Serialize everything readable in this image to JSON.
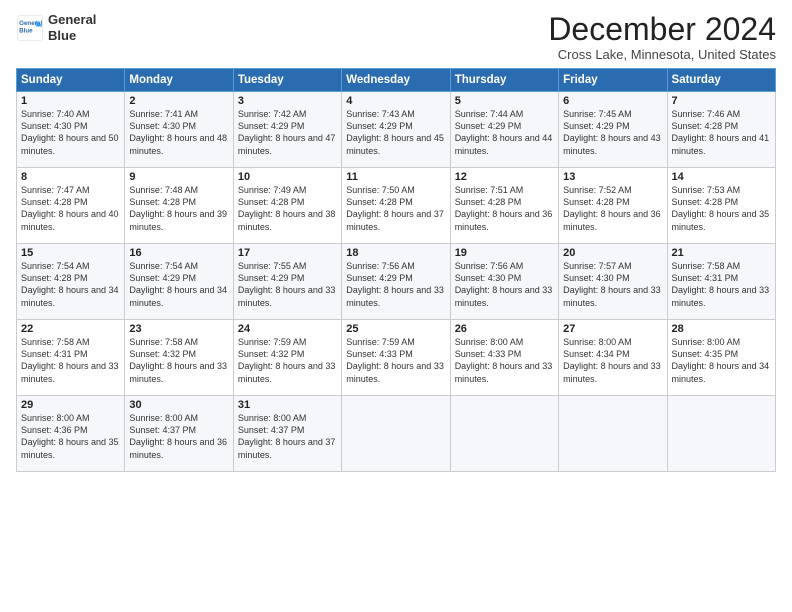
{
  "header": {
    "logo_line1": "General",
    "logo_line2": "Blue",
    "month_title": "December 2024",
    "location": "Cross Lake, Minnesota, United States"
  },
  "days_of_week": [
    "Sunday",
    "Monday",
    "Tuesday",
    "Wednesday",
    "Thursday",
    "Friday",
    "Saturday"
  ],
  "weeks": [
    [
      {
        "day": "1",
        "sunrise": "Sunrise: 7:40 AM",
        "sunset": "Sunset: 4:30 PM",
        "daylight": "Daylight: 8 hours and 50 minutes."
      },
      {
        "day": "2",
        "sunrise": "Sunrise: 7:41 AM",
        "sunset": "Sunset: 4:30 PM",
        "daylight": "Daylight: 8 hours and 48 minutes."
      },
      {
        "day": "3",
        "sunrise": "Sunrise: 7:42 AM",
        "sunset": "Sunset: 4:29 PM",
        "daylight": "Daylight: 8 hours and 47 minutes."
      },
      {
        "day": "4",
        "sunrise": "Sunrise: 7:43 AM",
        "sunset": "Sunset: 4:29 PM",
        "daylight": "Daylight: 8 hours and 45 minutes."
      },
      {
        "day": "5",
        "sunrise": "Sunrise: 7:44 AM",
        "sunset": "Sunset: 4:29 PM",
        "daylight": "Daylight: 8 hours and 44 minutes."
      },
      {
        "day": "6",
        "sunrise": "Sunrise: 7:45 AM",
        "sunset": "Sunset: 4:29 PM",
        "daylight": "Daylight: 8 hours and 43 minutes."
      },
      {
        "day": "7",
        "sunrise": "Sunrise: 7:46 AM",
        "sunset": "Sunset: 4:28 PM",
        "daylight": "Daylight: 8 hours and 41 minutes."
      }
    ],
    [
      {
        "day": "8",
        "sunrise": "Sunrise: 7:47 AM",
        "sunset": "Sunset: 4:28 PM",
        "daylight": "Daylight: 8 hours and 40 minutes."
      },
      {
        "day": "9",
        "sunrise": "Sunrise: 7:48 AM",
        "sunset": "Sunset: 4:28 PM",
        "daylight": "Daylight: 8 hours and 39 minutes."
      },
      {
        "day": "10",
        "sunrise": "Sunrise: 7:49 AM",
        "sunset": "Sunset: 4:28 PM",
        "daylight": "Daylight: 8 hours and 38 minutes."
      },
      {
        "day": "11",
        "sunrise": "Sunrise: 7:50 AM",
        "sunset": "Sunset: 4:28 PM",
        "daylight": "Daylight: 8 hours and 37 minutes."
      },
      {
        "day": "12",
        "sunrise": "Sunrise: 7:51 AM",
        "sunset": "Sunset: 4:28 PM",
        "daylight": "Daylight: 8 hours and 36 minutes."
      },
      {
        "day": "13",
        "sunrise": "Sunrise: 7:52 AM",
        "sunset": "Sunset: 4:28 PM",
        "daylight": "Daylight: 8 hours and 36 minutes."
      },
      {
        "day": "14",
        "sunrise": "Sunrise: 7:53 AM",
        "sunset": "Sunset: 4:28 PM",
        "daylight": "Daylight: 8 hours and 35 minutes."
      }
    ],
    [
      {
        "day": "15",
        "sunrise": "Sunrise: 7:54 AM",
        "sunset": "Sunset: 4:28 PM",
        "daylight": "Daylight: 8 hours and 34 minutes."
      },
      {
        "day": "16",
        "sunrise": "Sunrise: 7:54 AM",
        "sunset": "Sunset: 4:29 PM",
        "daylight": "Daylight: 8 hours and 34 minutes."
      },
      {
        "day": "17",
        "sunrise": "Sunrise: 7:55 AM",
        "sunset": "Sunset: 4:29 PM",
        "daylight": "Daylight: 8 hours and 33 minutes."
      },
      {
        "day": "18",
        "sunrise": "Sunrise: 7:56 AM",
        "sunset": "Sunset: 4:29 PM",
        "daylight": "Daylight: 8 hours and 33 minutes."
      },
      {
        "day": "19",
        "sunrise": "Sunrise: 7:56 AM",
        "sunset": "Sunset: 4:30 PM",
        "daylight": "Daylight: 8 hours and 33 minutes."
      },
      {
        "day": "20",
        "sunrise": "Sunrise: 7:57 AM",
        "sunset": "Sunset: 4:30 PM",
        "daylight": "Daylight: 8 hours and 33 minutes."
      },
      {
        "day": "21",
        "sunrise": "Sunrise: 7:58 AM",
        "sunset": "Sunset: 4:31 PM",
        "daylight": "Daylight: 8 hours and 33 minutes."
      }
    ],
    [
      {
        "day": "22",
        "sunrise": "Sunrise: 7:58 AM",
        "sunset": "Sunset: 4:31 PM",
        "daylight": "Daylight: 8 hours and 33 minutes."
      },
      {
        "day": "23",
        "sunrise": "Sunrise: 7:58 AM",
        "sunset": "Sunset: 4:32 PM",
        "daylight": "Daylight: 8 hours and 33 minutes."
      },
      {
        "day": "24",
        "sunrise": "Sunrise: 7:59 AM",
        "sunset": "Sunset: 4:32 PM",
        "daylight": "Daylight: 8 hours and 33 minutes."
      },
      {
        "day": "25",
        "sunrise": "Sunrise: 7:59 AM",
        "sunset": "Sunset: 4:33 PM",
        "daylight": "Daylight: 8 hours and 33 minutes."
      },
      {
        "day": "26",
        "sunrise": "Sunrise: 8:00 AM",
        "sunset": "Sunset: 4:33 PM",
        "daylight": "Daylight: 8 hours and 33 minutes."
      },
      {
        "day": "27",
        "sunrise": "Sunrise: 8:00 AM",
        "sunset": "Sunset: 4:34 PM",
        "daylight": "Daylight: 8 hours and 33 minutes."
      },
      {
        "day": "28",
        "sunrise": "Sunrise: 8:00 AM",
        "sunset": "Sunset: 4:35 PM",
        "daylight": "Daylight: 8 hours and 34 minutes."
      }
    ],
    [
      {
        "day": "29",
        "sunrise": "Sunrise: 8:00 AM",
        "sunset": "Sunset: 4:36 PM",
        "daylight": "Daylight: 8 hours and 35 minutes."
      },
      {
        "day": "30",
        "sunrise": "Sunrise: 8:00 AM",
        "sunset": "Sunset: 4:37 PM",
        "daylight": "Daylight: 8 hours and 36 minutes."
      },
      {
        "day": "31",
        "sunrise": "Sunrise: 8:00 AM",
        "sunset": "Sunset: 4:37 PM",
        "daylight": "Daylight: 8 hours and 37 minutes."
      },
      null,
      null,
      null,
      null
    ]
  ]
}
